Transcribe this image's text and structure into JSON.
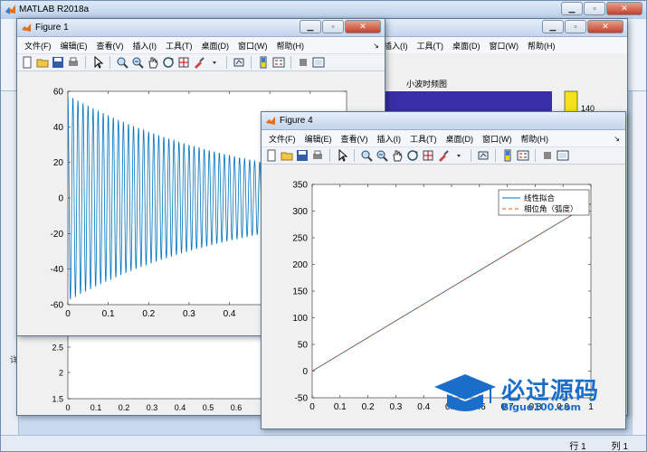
{
  "app": {
    "title": "MATLAB R2018a"
  },
  "status": {
    "row_label": "行",
    "row_value": "1",
    "col_label": "列",
    "col_value": "1"
  },
  "menu": [
    "文件(F)",
    "编辑(E)",
    "查看(V)",
    "插入(I)",
    "工具(T)",
    "桌面(D)",
    "窗口(W)",
    "帮助(H)"
  ],
  "back_figure": {
    "menu_visible": [
      "插入(I)",
      "工具(T)",
      "桌面(D)",
      "窗口(W)",
      "帮助(H)"
    ],
    "bar_title": "小波时频图",
    "colorbar_tick": "140"
  },
  "figure1": {
    "title": "Figure 1"
  },
  "figure4": {
    "title": "Figure 4"
  },
  "side_text": "详",
  "watermark": {
    "text": "必过源码",
    "sub": "Bigue100.com"
  },
  "chart_data": [
    {
      "type": "line",
      "figure": "Figure 1",
      "xlim": [
        0,
        0.69
      ],
      "ylim": [
        -60,
        60
      ],
      "xticks": [
        0,
        0.1,
        0.2,
        0.3,
        0.4,
        0.5,
        0.6
      ],
      "yticks": [
        60,
        40,
        20,
        0,
        -20,
        -40,
        -60
      ],
      "series": [
        {
          "kind": "damped-sine",
          "amplitude": 58,
          "decay": 2.2,
          "frequency_hz": 80,
          "color": "#0072bd"
        }
      ]
    },
    {
      "type": "line",
      "figure": "Figure 4",
      "xlim": [
        0,
        1
      ],
      "ylim": [
        -50,
        350
      ],
      "xticks": [
        0,
        0.1,
        0.2,
        0.3,
        0.4,
        0.5,
        0.6,
        0.7,
        0.8,
        0.9,
        1
      ],
      "yticks": [
        350,
        300,
        250,
        200,
        150,
        100,
        50,
        0,
        -50
      ],
      "series": [
        {
          "name": "线性拟合",
          "x": [
            0,
            1
          ],
          "y": [
            0,
            314
          ],
          "color": "#0072bd",
          "style": "solid"
        },
        {
          "name": "相位角（弧度）",
          "x": [
            0,
            1
          ],
          "y": [
            0,
            314
          ],
          "color": "#d95319",
          "style": "dashed"
        }
      ],
      "legend": "top-right"
    },
    {
      "type": "line",
      "figure": "background figure (partially visible)",
      "yticks_visible": [
        2.5,
        2,
        1.5
      ],
      "xticks": [
        0,
        0.1,
        0.2,
        0.3,
        0.4,
        0.5,
        0.6
      ]
    }
  ]
}
